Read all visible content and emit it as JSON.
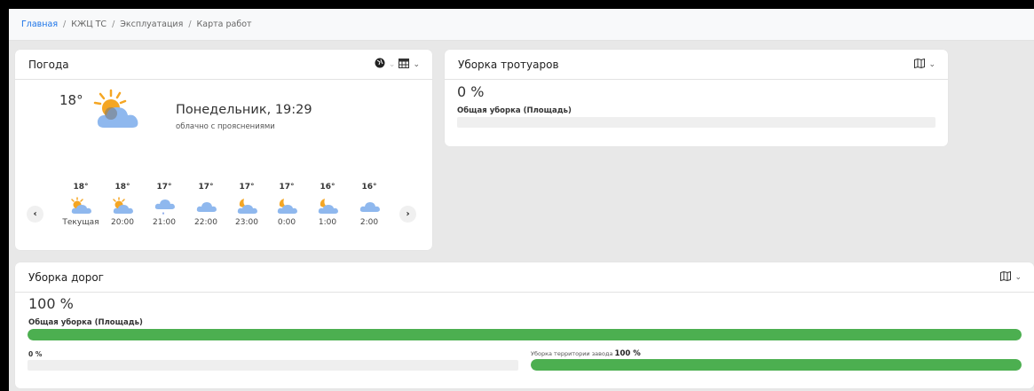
{
  "breadcrumb": {
    "items": [
      "Главная",
      "КЖЦ ТС",
      "Эксплуатация",
      "Карта работ"
    ],
    "separator": "/"
  },
  "weather": {
    "title": "Погода",
    "current": {
      "temp": "18°",
      "day_time": "Понедельник, 19:29",
      "description": "облачно с прояснениями",
      "icon": "partly-cloudy-sun-icon"
    },
    "forecast": [
      {
        "temp": "18°",
        "time": "Текущая",
        "icon": "partly-cloudy-sun-icon"
      },
      {
        "temp": "18°",
        "time": "20:00",
        "icon": "partly-cloudy-sun-icon"
      },
      {
        "temp": "17°",
        "time": "21:00",
        "icon": "cloud-rain-icon"
      },
      {
        "temp": "17°",
        "time": "22:00",
        "icon": "cloud-icon"
      },
      {
        "temp": "17°",
        "time": "23:00",
        "icon": "cloud-moon-icon"
      },
      {
        "temp": "17°",
        "time": "0:00",
        "icon": "cloud-moon-icon"
      },
      {
        "temp": "16°",
        "time": "1:00",
        "icon": "cloud-moon-icon"
      },
      {
        "temp": "16°",
        "time": "2:00",
        "icon": "cloud-icon"
      }
    ]
  },
  "sidewalks": {
    "title": "Уборка тротуаров",
    "percent": "0 %",
    "label": "Общая уборка (Площадь)",
    "progress": 0
  },
  "roads": {
    "title": "Уборка дорог",
    "percent": "100 %",
    "label": "Общая уборка (Площадь)",
    "progress": 1.0,
    "sub_left": {
      "value": "0 %",
      "progress": 0
    },
    "sub_right": {
      "label": "Уборка территории завода",
      "value": "100 %",
      "progress": 1.0
    }
  },
  "colors": {
    "accent": "#1a73e8",
    "progress": "#4caf50",
    "track": "#efefef"
  }
}
